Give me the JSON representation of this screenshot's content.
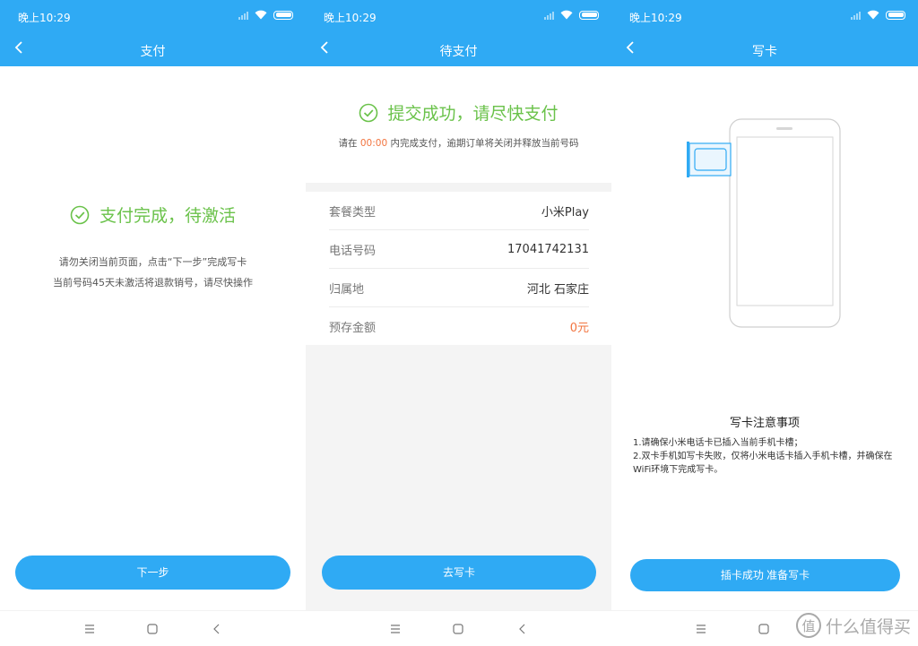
{
  "colors": {
    "accent": "#2faaf4",
    "success": "#6ac24a",
    "highlight": "#f2743f"
  },
  "status_bar": {
    "time": "晚上10:29"
  },
  "panel1": {
    "nav_title": "支付",
    "success_text": "支付完成，待激活",
    "note_line1": "请勿关闭当前页面，点击“下一步”完成写卡",
    "note_line2": "当前号码45天未激活将退款销号，请尽快操作",
    "button": "下一步"
  },
  "panel2": {
    "nav_title": "待支付",
    "success_text": "提交成功，请尽快支付",
    "note_prefix": "请在",
    "note_time": "00:00",
    "note_suffix": "内完成支付，逾期订单将关闭并释放当前号码",
    "rows": [
      {
        "label": "套餐类型",
        "value": "小米Play"
      },
      {
        "label": "电话号码",
        "value": "17041742131"
      },
      {
        "label": "归属地",
        "value": "河北 石家庄"
      },
      {
        "label": "预存金额",
        "value": "0元"
      }
    ],
    "button": "去写卡"
  },
  "panel3": {
    "nav_title": "写卡",
    "tips_title": "写卡注意事项",
    "tip1": "1.请确保小米电话卡已插入当前手机卡槽；",
    "tip2": "2.双卡手机如写卡失败，仅将小米电话卡插入手机卡槽，并确保在WiFi环境下完成写卡。",
    "button": "插卡成功 准备写卡"
  },
  "icons": [
    "back-icon",
    "check-circle-icon",
    "phone-sim-illustration",
    "menu-icon",
    "home-icon",
    "back-nav-icon",
    "signal-icon",
    "wifi-icon",
    "battery-icon"
  ],
  "watermark": {
    "text": "什么值得买",
    "logo_glyph": "值"
  }
}
